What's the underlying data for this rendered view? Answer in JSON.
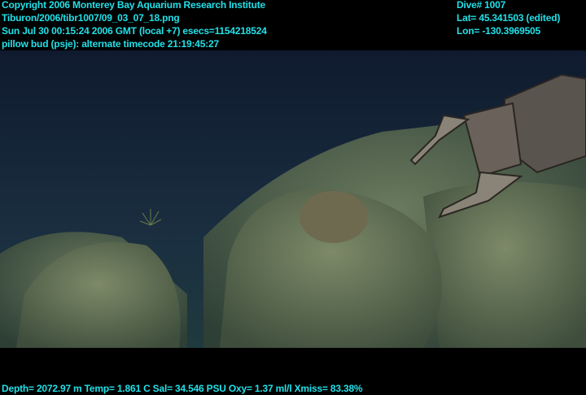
{
  "header_left": {
    "copyright": "Copyright 2006 Monterey Bay Aquarium Research Institute",
    "file_path": "Tiburon/2006/tibr1007/09_03_07_18.png",
    "timestamp": "Sun Jul 30 00:15:24 2006 GMT (local +7)  esecs=1154218524",
    "timecode": "pillow bud (psje): alternate timecode 21:19:45:27"
  },
  "header_right": {
    "dive": "Dive# 1007",
    "lat": "Lat= 45.341503 (edited)",
    "lon": "Lon= -130.3969505"
  },
  "footer": {
    "sensors": "Depth= 2072.97 m  Temp= 1.861 C  Sal= 34.546 PSU  Oxy= 1.37 ml/l  Xmiss= 83.38%"
  },
  "colors": {
    "overlay_text": "#22e0e8",
    "water": "#16243a",
    "rock": "#5f6f52"
  }
}
